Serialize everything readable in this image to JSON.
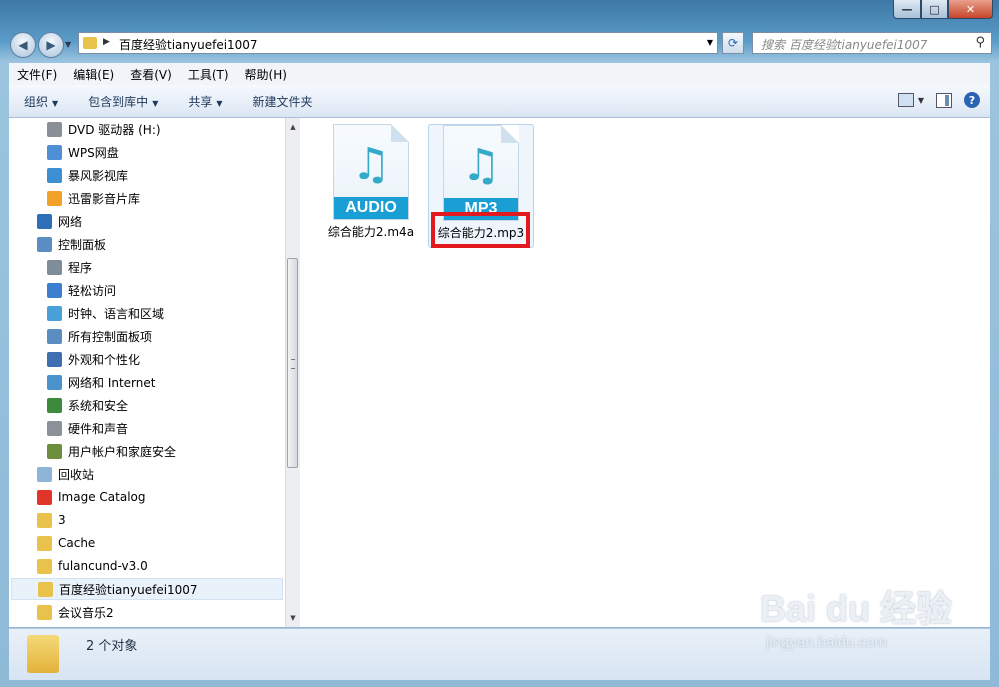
{
  "window": {
    "caption_buttons": [
      "—",
      "□",
      "✕"
    ]
  },
  "nav": {
    "back": "◀",
    "forward": "▶",
    "address_path": "百度经验tianyuefei1007",
    "search_placeholder": "搜索 百度经验tianyuefei1007"
  },
  "menu": [
    "文件(F)",
    "编辑(E)",
    "查看(V)",
    "工具(T)",
    "帮助(H)"
  ],
  "commands": {
    "organize": "组织",
    "include_in_library": "包含到库中",
    "share": "共享",
    "new_folder": "新建文件夹",
    "help": "?"
  },
  "tree": [
    {
      "label": "DVD 驱动器 (H:)",
      "icon": "dvd-drive-icon",
      "color": "#8a8f97"
    },
    {
      "label": "WPS网盘",
      "icon": "cloud-icon",
      "color": "#4e8fd6"
    },
    {
      "label": "暴风影视库",
      "icon": "video-library-icon",
      "color": "#3b8fd2"
    },
    {
      "label": "迅雷影音片库",
      "icon": "video-play-icon",
      "color": "#f2a12b"
    },
    {
      "label": "网络",
      "icon": "network-icon",
      "color": "#2f6eb8"
    },
    {
      "label": "控制面板",
      "icon": "control-panel-icon",
      "color": "#5a8ec2"
    },
    {
      "label": "程序",
      "icon": "programs-icon",
      "color": "#7f8c99"
    },
    {
      "label": "轻松访问",
      "icon": "ease-of-access-icon",
      "color": "#3d7fcf"
    },
    {
      "label": "时钟、语言和区域",
      "icon": "clock-globe-icon",
      "color": "#4aa0d8"
    },
    {
      "label": "所有控制面板项",
      "icon": "control-panel-items-icon",
      "color": "#5a8ec2"
    },
    {
      "label": "外观和个性化",
      "icon": "appearance-icon",
      "color": "#3f6fb0"
    },
    {
      "label": "网络和 Internet",
      "icon": "network-internet-icon",
      "color": "#4b93cf"
    },
    {
      "label": "系统和安全",
      "icon": "system-security-icon",
      "color": "#3d8a3d"
    },
    {
      "label": "硬件和声音",
      "icon": "hardware-sound-icon",
      "color": "#8b9198"
    },
    {
      "label": "用户帐户和家庭安全",
      "icon": "user-accounts-icon",
      "color": "#6b8f3c"
    },
    {
      "label": "回收站",
      "icon": "recycle-bin-icon",
      "color": "#8eb4d6"
    },
    {
      "label": "Image Catalog",
      "icon": "image-catalog-icon",
      "color": "#e0352b"
    },
    {
      "label": "3",
      "icon": "folder-icon",
      "color": "#e8c24a"
    },
    {
      "label": "Cache",
      "icon": "folder-icon",
      "color": "#e8c24a"
    },
    {
      "label": "fulancund-v3.0",
      "icon": "folder-icon",
      "color": "#e8c24a"
    },
    {
      "label": "百度经验tianyuefei1007",
      "icon": "folder-icon",
      "color": "#e8c24a",
      "selected": true
    },
    {
      "label": "会议音乐2",
      "icon": "folder-icon",
      "color": "#e8c24a"
    }
  ],
  "files": [
    {
      "name": "综合能力2.m4a",
      "tag": "AUDIO"
    },
    {
      "name": "综合能力2.mp3",
      "tag": "MP3"
    }
  ],
  "status": {
    "count": "2 个对象"
  },
  "watermark": {
    "line1": "Bai du 经验",
    "line2": "jingyan.baidu.com"
  }
}
